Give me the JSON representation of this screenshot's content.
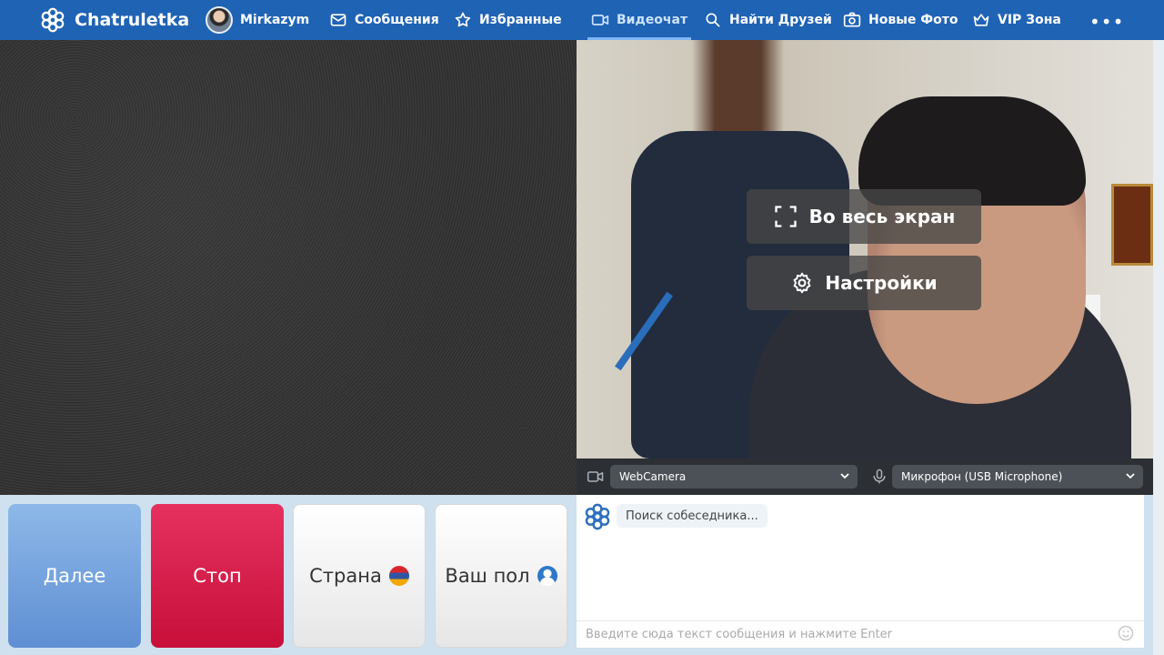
{
  "nav": {
    "brand": "Chatruletka",
    "user": "Mirkazym",
    "items": [
      {
        "label": "Сообщения",
        "icon": "mail-icon"
      },
      {
        "label": "Избранные",
        "icon": "star-icon"
      },
      {
        "label": "Видеочат",
        "icon": "video-icon",
        "active": true
      },
      {
        "label": "Найти Друзей",
        "icon": "search-icon"
      },
      {
        "label": "Новые Фото",
        "icon": "camera-icon"
      },
      {
        "label": "VIP Зона",
        "icon": "crown-icon"
      }
    ],
    "more": "•••"
  },
  "video": {
    "fullscreen_label": "Во весь экран",
    "settings_label": "Настройки"
  },
  "devices": {
    "camera": "WebCamera",
    "microphone": "Микрофон (USB Microphone)"
  },
  "controls": {
    "next": "Далее",
    "stop": "Стоп",
    "country": "Страна",
    "gender": "Ваш пол"
  },
  "chat": {
    "status": "Поиск собеседника...",
    "input_placeholder": "Введите сюда текст сообщения и нажмите Enter"
  },
  "colors": {
    "nav_bg": "#1f63b5",
    "next_btn": "#6f9fdd",
    "stop_btn": "#d61b48"
  }
}
